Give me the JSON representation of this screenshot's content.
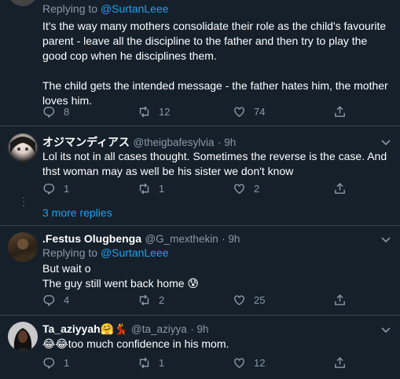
{
  "tweet1": {
    "replying_prefix": "Replying to ",
    "replying_to": "@SurtanLeee",
    "text_para1": "It's the way many mothers consolidate their role as the child's favourite parent - leave all the discipline to the father and then try to play the good cop when he disciplines them.",
    "text_para2": "The child gets the intended message - the father hates him, the mother loves him.",
    "replies": "8",
    "retweets": "12",
    "likes": "74"
  },
  "tweet2": {
    "display_name": "オジマンディアス",
    "handle": "@theigbafesylvia",
    "time": "· 9h",
    "text": "Lol its not in all cases thought. Sometimes the reverse is the case. And thst woman may as well be his sister we don't know",
    "replies": "1",
    "retweets": "1",
    "likes": "2"
  },
  "more_replies": "3 more replies",
  "tweet3": {
    "display_name": ".Festus Olugbenga",
    "handle": "@G_mexthekin",
    "time": "· 9h",
    "replying_prefix": "Replying to ",
    "replying_to": "@SurtanLeee",
    "text_line1": "But wait o",
    "text_line2": "The guy still went back home 😰",
    "replies": "4",
    "retweets": "2",
    "likes": "25"
  },
  "tweet4": {
    "display_name": "Ta_aziyyah🤗💃",
    "handle": "@ta_aziyya",
    "time": "· 9h",
    "text": "😂😂too much confidence in his mom.",
    "replies": "1",
    "retweets": "1",
    "likes": "12"
  },
  "colors": {
    "background": "#15202b",
    "accent": "#1da1f2",
    "muted": "#8899a6",
    "divider": "#38444d"
  }
}
